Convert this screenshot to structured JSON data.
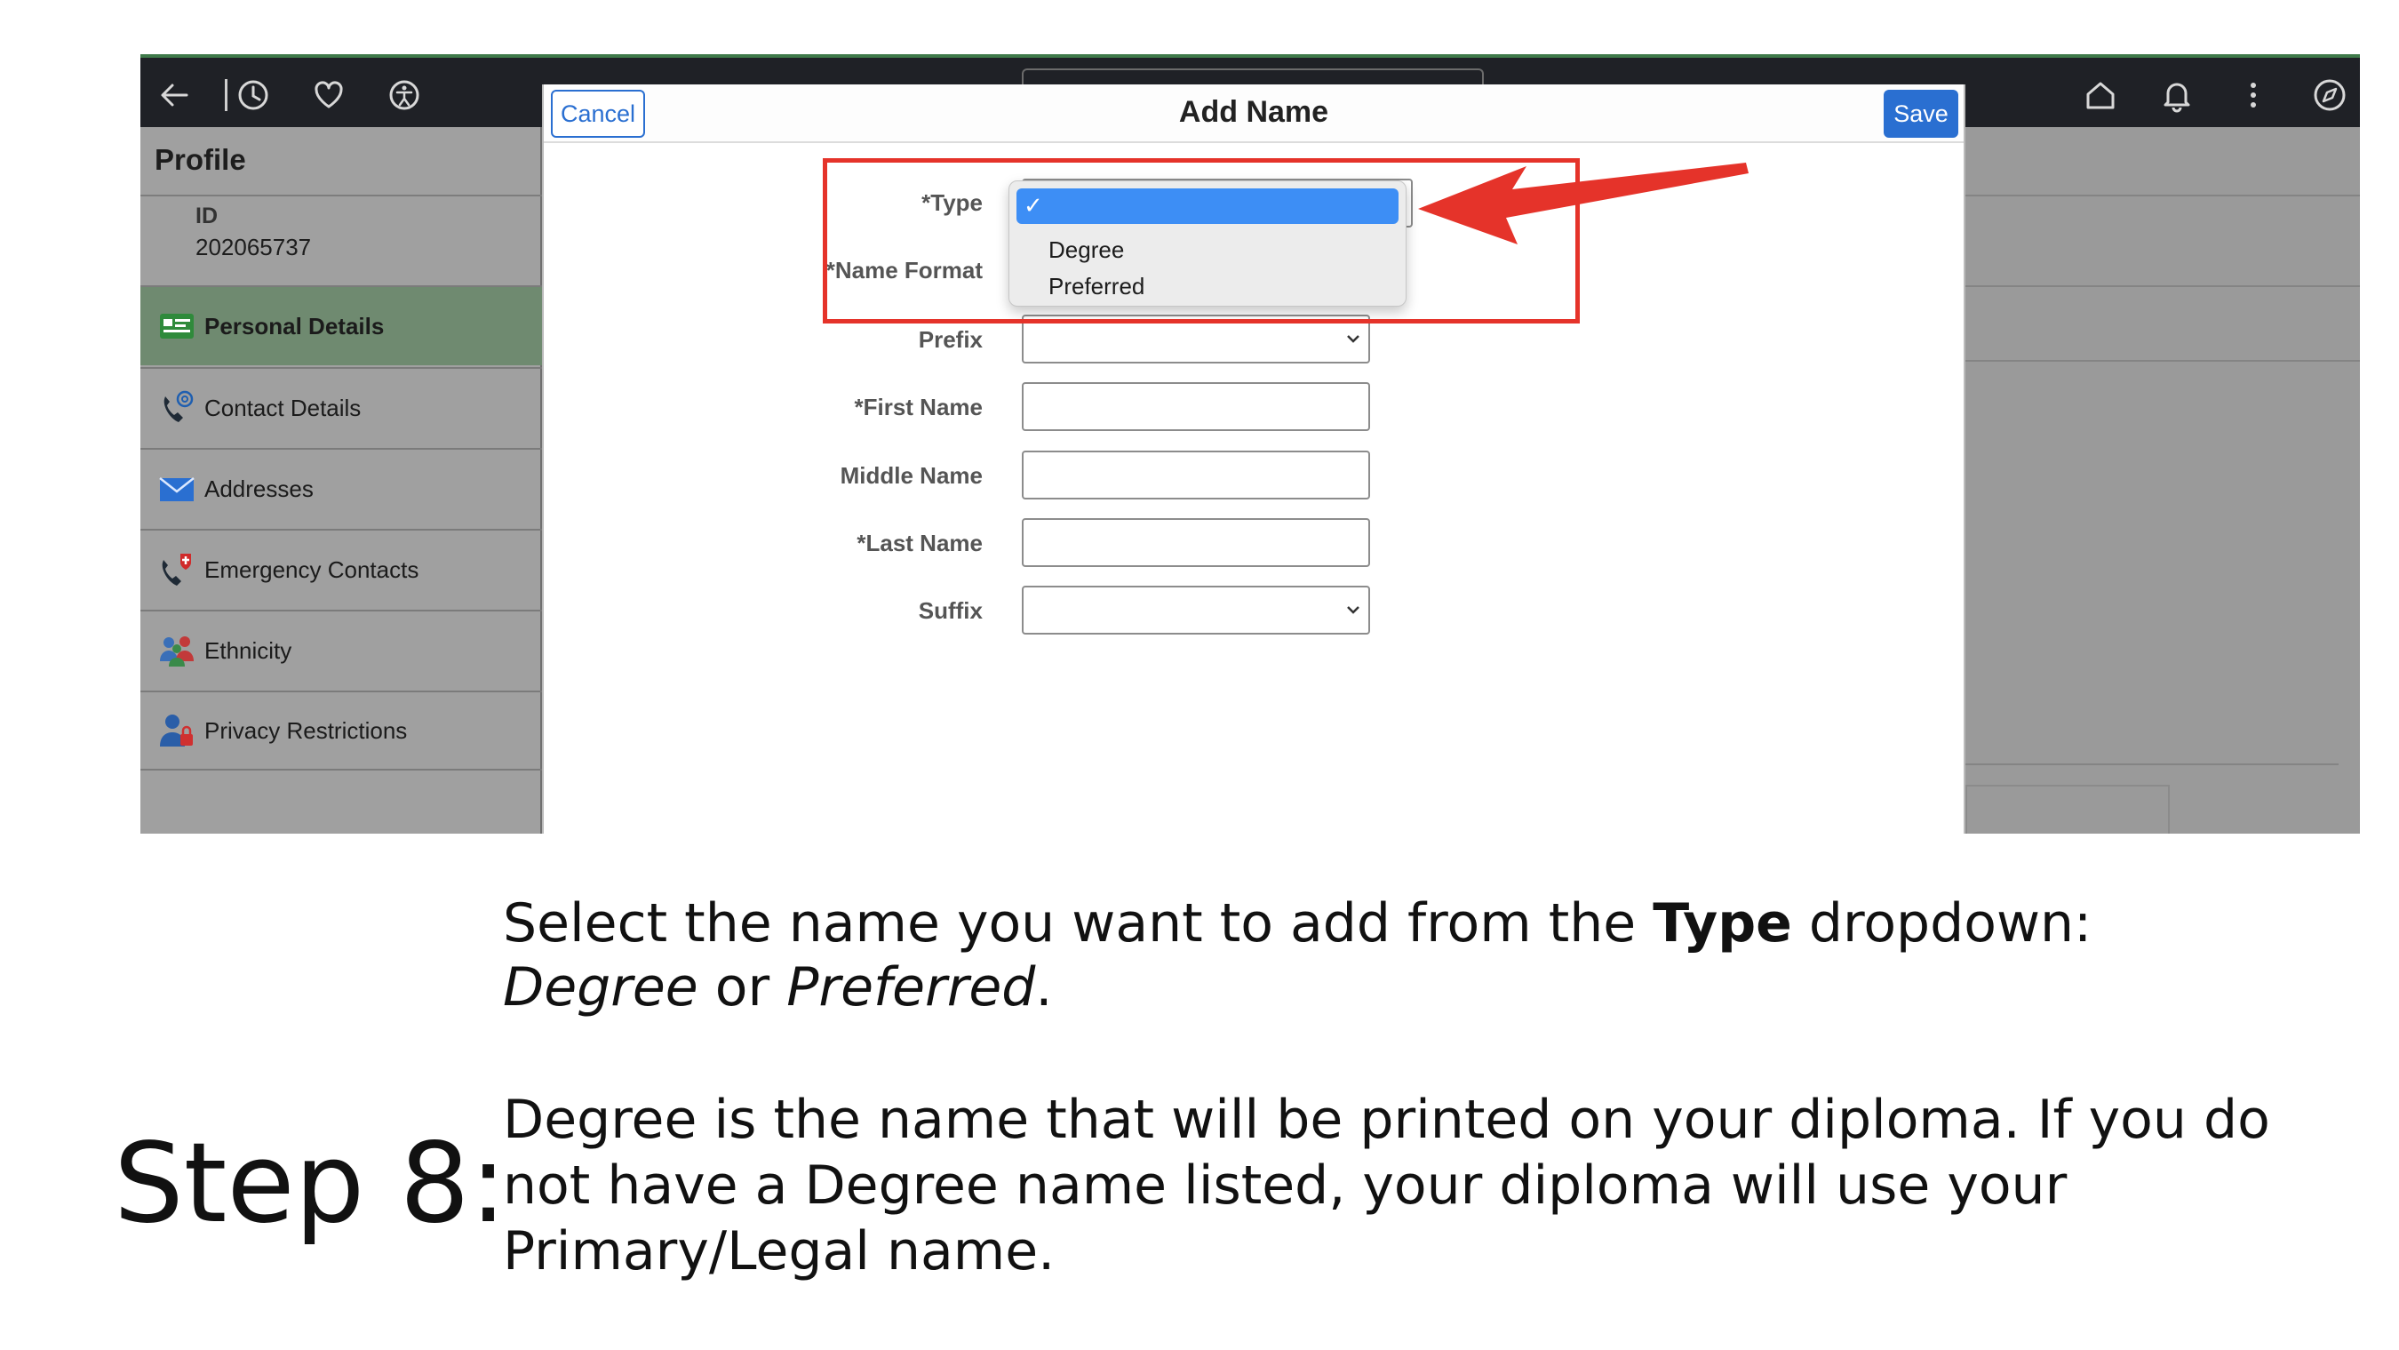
{
  "topbar": {
    "icons": [
      "back-arrow-icon",
      "history-icon",
      "favorites-heart-icon",
      "accessibility-icon",
      "home-icon",
      "bell-icon",
      "more-vertical-icon",
      "compass-icon"
    ]
  },
  "sidebar": {
    "title": "Profile",
    "id_label": "ID",
    "id_value": "202065737",
    "items": [
      {
        "label": "Personal Details",
        "icon": "id-card-icon"
      },
      {
        "label": "Contact Details",
        "icon": "phone-at-icon"
      },
      {
        "label": "Addresses",
        "icon": "envelope-icon"
      },
      {
        "label": "Emergency Contacts",
        "icon": "emergency-phone-icon"
      },
      {
        "label": "Ethnicity",
        "icon": "people-icon"
      },
      {
        "label": "Privacy Restrictions",
        "icon": "person-lock-icon"
      }
    ]
  },
  "modal": {
    "title": "Add Name",
    "cancel_label": "Cancel",
    "save_label": "Save",
    "fields": {
      "type": "*Type",
      "name_format": "*Name Format",
      "prefix": "Prefix",
      "first_name": "*First Name",
      "middle_name": "Middle Name",
      "last_name": "*Last Name",
      "suffix": "Suffix"
    },
    "type_dropdown": {
      "selected_mark": "✓",
      "options": [
        "Degree",
        "Preferred"
      ]
    }
  },
  "instructions": {
    "step": "Step 8:",
    "p1": {
      "a": "Select the name you want to add from the ",
      "b": "Type",
      "c": " dropdown: ",
      "d": "Degree",
      "e": " or ",
      "f": "Preferred",
      "g": "."
    },
    "p2": "Degree is the name that will be printed on your diploma. If you do not have a Degree name listed, your diploma will use your Primary/Legal name."
  },
  "colors": {
    "accent": "#2a6fd1",
    "highlight": "#e5332a",
    "selection": "#3d8ef5",
    "active_nav": "#6f8a70"
  }
}
